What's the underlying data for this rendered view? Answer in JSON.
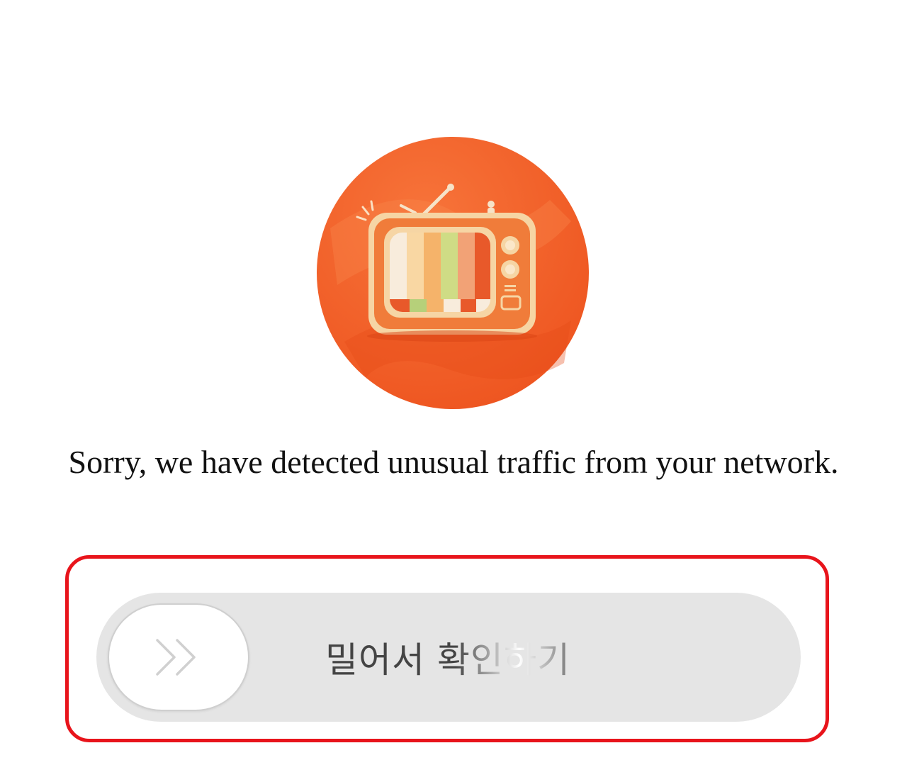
{
  "illustration": {
    "icon": "retro-tv-icon",
    "colors": {
      "circle": "#f4642a",
      "tv_body": "#f07c3a",
      "screen_stripes": [
        "#f7ead7",
        "#f7c98a",
        "#f3a35a",
        "#c7d77a",
        "#f0a070",
        "#e8592a"
      ]
    }
  },
  "message": {
    "text": "Sorry, we have detected unusual traffic from your network."
  },
  "slider": {
    "label": "밀어서 확인하기",
    "handle_icon": "double-chevron-right-icon",
    "progress": 0
  },
  "highlight": {
    "color": "#e8141b"
  }
}
